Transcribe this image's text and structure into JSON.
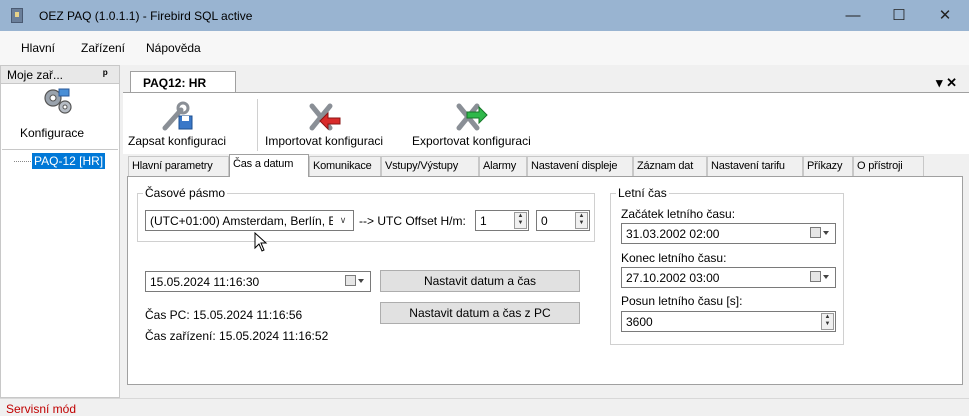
{
  "window": {
    "title": "OEZ PAQ (1.0.1.1) - Firebird SQL active",
    "minimize": "—",
    "maximize": "☐",
    "close": "✕"
  },
  "menu": {
    "items": [
      "Hlavní",
      "Zařízení",
      "Nápověda"
    ]
  },
  "sidebar": {
    "header": "Moje zař...",
    "pin": "ᵖ",
    "config_label": "Konfigurace",
    "tree_item": "PAQ-12 [HR]"
  },
  "document": {
    "tab_title": "PAQ12: HR",
    "tab_controls": "▾ ✕"
  },
  "toolbar": {
    "save": "Zapsat konfiguraci",
    "import": "Importovat konfiguraci",
    "export": "Exportovat konfiguraci"
  },
  "tabs": [
    "Hlavní parametry",
    "Čas a datum",
    "Komunikace",
    "Vstupy/Výstupy",
    "Alarmy",
    "Nastavení displeje",
    "Záznam dat",
    "Nastavení tarifu",
    "Příkazy",
    "O přístroji"
  ],
  "timezone": {
    "group_label": "Časové pásmo",
    "value": "(UTC+01:00) Amsterdam, Berlín, E",
    "utc_label": "--> UTC Offset H/m:",
    "offset_h": "1",
    "offset_m": "0"
  },
  "datetime": {
    "value": "15.05.2024  11:16:30",
    "set_button": "Nastavit datum a čas",
    "set_pc_button": "Nastavit datum a čas z PC",
    "pc_time": "Čas PC: 15.05.2024 11:16:56",
    "device_time": "Čas zařízení: 15.05.2024 11:16:52"
  },
  "dst": {
    "group_label": "Letní čas",
    "start_label": "Začátek letního času:",
    "start_value": "31.03.2002  02:00",
    "end_label": "Konec letního času:",
    "end_value": "27.10.2002  03:00",
    "shift_label": "Posun letního času [s]:",
    "shift_value": "3600"
  },
  "status": {
    "text": "Servisní mód"
  }
}
